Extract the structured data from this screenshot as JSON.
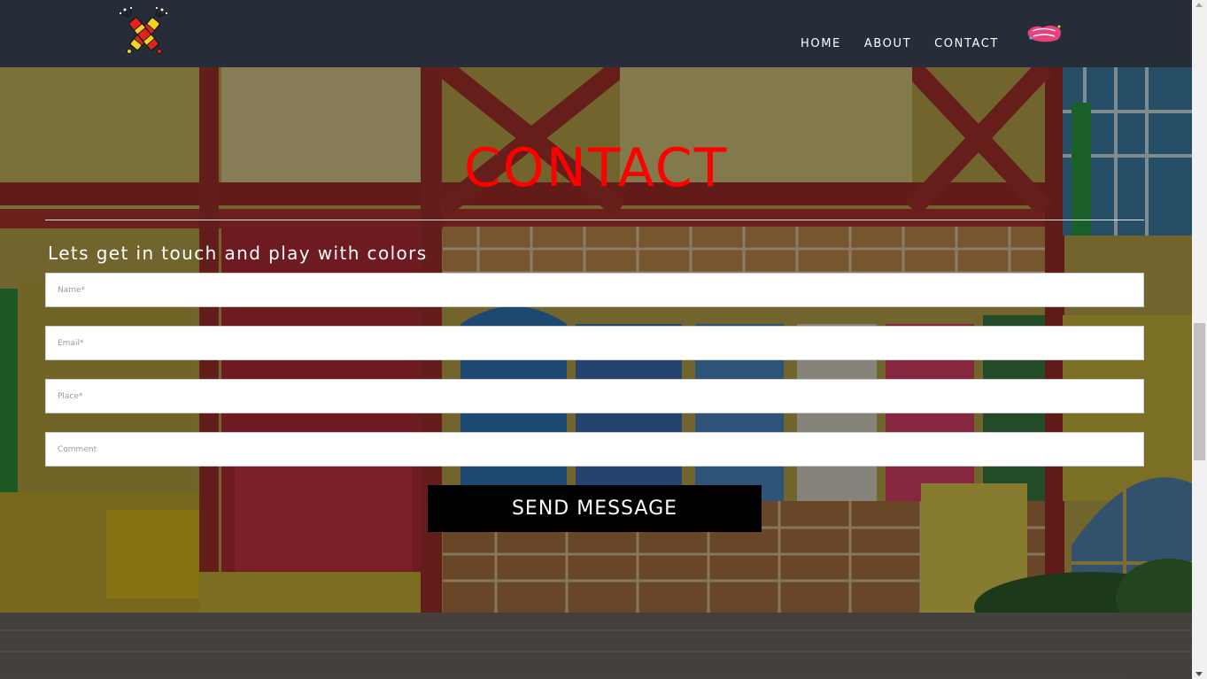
{
  "header": {
    "logo_icon": "crossed-firecrackers-logo-icon",
    "nav": [
      {
        "label": "HOME"
      },
      {
        "label": "ABOUT"
      },
      {
        "label": "CONTACT"
      }
    ],
    "badge_icon": "happy-holi-badge-icon",
    "background_color": "#272d38"
  },
  "contact": {
    "title": "CONTACT",
    "title_color": "#ff0000",
    "subtitle": "Lets get in touch and play with colors",
    "form": {
      "name_placeholder": "Name*",
      "email_placeholder": "Email*",
      "place_placeholder": "Place*",
      "comment_placeholder": "Comment",
      "submit_label": "SEND MESSAGE"
    }
  },
  "background": {
    "description_icon": "painted-wall-mural-image"
  }
}
